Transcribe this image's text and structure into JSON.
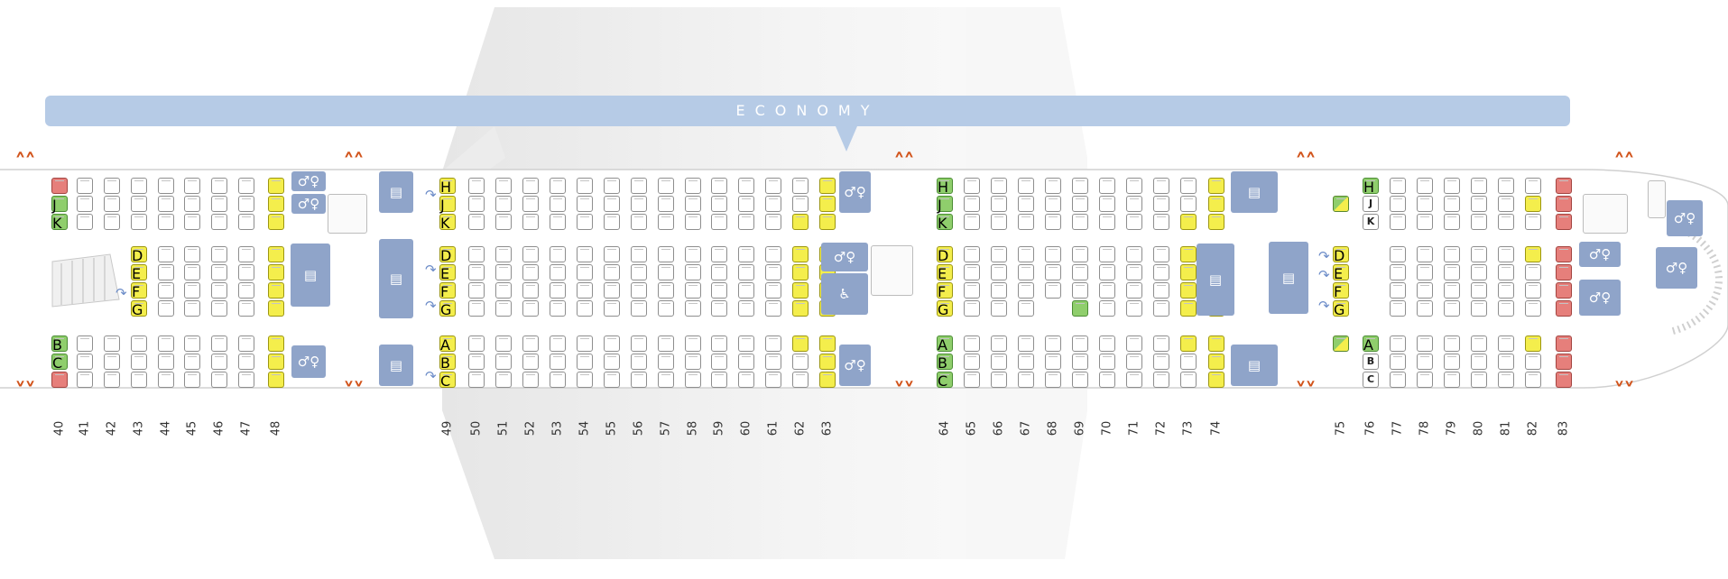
{
  "cabin": {
    "label": "ECONOMY"
  },
  "row_numbers": [
    "40",
    "41",
    "42",
    "43",
    "44",
    "45",
    "46",
    "47",
    "48",
    "49",
    "50",
    "51",
    "52",
    "53",
    "54",
    "55",
    "56",
    "57",
    "58",
    "59",
    "60",
    "61",
    "62",
    "63",
    "64",
    "65",
    "66",
    "67",
    "68",
    "69",
    "70",
    "71",
    "72",
    "73",
    "74",
    "75",
    "76",
    "77",
    "78",
    "79",
    "80",
    "81",
    "82",
    "83"
  ],
  "seat_letters": {
    "upper_group": [
      "H",
      "J",
      "K"
    ],
    "center_group": [
      "D",
      "E",
      "F",
      "G"
    ],
    "lower_group": [
      "A",
      "B",
      "C"
    ],
    "upper_pair": [
      "J",
      "K"
    ],
    "lower_pair": [
      "B",
      "C"
    ]
  },
  "legend_colors": {
    "standard": "#ffffff",
    "preferred": "#f4ee4c",
    "restricted": "#e67f7b",
    "good": "#8fce6c",
    "facility": "#8fa4c9",
    "exit": "#d2551d",
    "banner": "#b6cbe6"
  },
  "icons": {
    "lavatory": "lavatory-icon",
    "galley": "galley-icon",
    "accessible_lavatory": "wheelchair-icon",
    "exit": "exit-chevron-icon"
  }
}
